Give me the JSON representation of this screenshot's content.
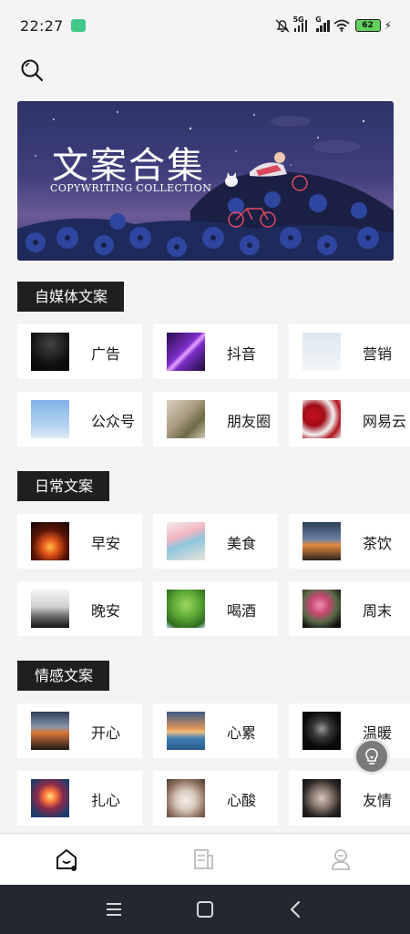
{
  "status_bar": {
    "time": "22:27",
    "network_label": "5G",
    "network_label_2": "G",
    "battery": "62"
  },
  "banner": {
    "title": "文案合集",
    "subtitle": "COPYWRITING COLLECTION"
  },
  "sections": [
    {
      "title": "自媒体文案",
      "items": [
        {
          "label": "广告",
          "thumb": "dark-bottle"
        },
        {
          "label": "抖音",
          "thumb": "purple-light"
        },
        {
          "label": "营销",
          "thumb": "snow-tree"
        },
        {
          "label": "公众号",
          "thumb": "ferris-wheel"
        },
        {
          "label": "朋友圈",
          "thumb": "flowers-table"
        },
        {
          "label": "网易云",
          "thumb": "red-berries"
        }
      ]
    },
    {
      "title": "日常文案",
      "items": [
        {
          "label": "早安",
          "thumb": "campfire"
        },
        {
          "label": "美食",
          "thumb": "macarons"
        },
        {
          "label": "茶饮",
          "thumb": "car-mirror-sunset"
        },
        {
          "label": "晚安",
          "thumb": "misty-hills"
        },
        {
          "label": "喝酒",
          "thumb": "green-tree"
        },
        {
          "label": "周末",
          "thumb": "flower-bouquet"
        }
      ]
    },
    {
      "title": "情感文案",
      "items": [
        {
          "label": "开心",
          "thumb": "car-mirror"
        },
        {
          "label": "心累",
          "thumb": "sea-sunset"
        },
        {
          "label": "温暖",
          "thumb": "dark-flower"
        },
        {
          "label": "扎心",
          "thumb": "fireworks"
        },
        {
          "label": "心酸",
          "thumb": "cat-toy"
        },
        {
          "label": "友情",
          "thumb": "holding-hands"
        }
      ]
    }
  ],
  "fab_icon": "lightbulb-icon",
  "bottom_nav": [
    "home-icon",
    "document-icon",
    "profile-icon"
  ],
  "colors": {
    "background": "#f4f4f4",
    "section_title_bg": "#1f1f1f",
    "card_bg": "#ffffff",
    "system_nav_bg": "#232730"
  }
}
